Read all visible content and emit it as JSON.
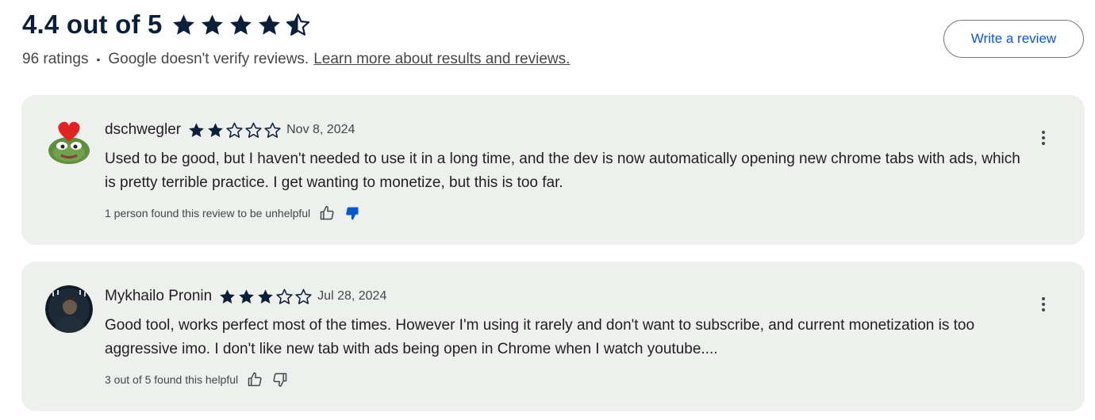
{
  "summary": {
    "rating_title": "4.4 out of 5",
    "rating_value": 4.4,
    "star_color": "#0b1f3a",
    "ratings_count": "96 ratings",
    "separator": "•",
    "verify_notice": "Google doesn't verify reviews.",
    "learn_more_link": "Learn more about results and reviews.",
    "write_review_label": "Write a review"
  },
  "reviews": [
    {
      "author": "dschwegler",
      "rating": 2,
      "date": "Nov 8, 2024",
      "text": "Used to be good, but I haven't needed to use it in a long time, and the dev is now automatically opening new chrome tabs with ads, which is pretty terrible practice. I get wanting to monetize, but this is too far.",
      "helpful_text": "1 person found this review to be unhelpful",
      "voted": "thumbs-down",
      "avatar_icon": "pepe-heart-avatar"
    },
    {
      "author": "Mykhailo Pronin",
      "rating": 3,
      "date": "Jul 28, 2024",
      "text": "Good tool, works perfect most of the times. However I'm using it rarely and don't want to subscribe, and current monetization is too aggressive imo. I don't like new tab with ads being open in Chrome when I watch youtube....",
      "helpful_text": "3 out of 5 found this helpful",
      "voted": "none",
      "avatar_icon": "photo-avatar"
    }
  ],
  "colors": {
    "card_bg": "#eef0ee",
    "vote_active": "#0b57d0",
    "link_blue": "#0b57d0"
  }
}
